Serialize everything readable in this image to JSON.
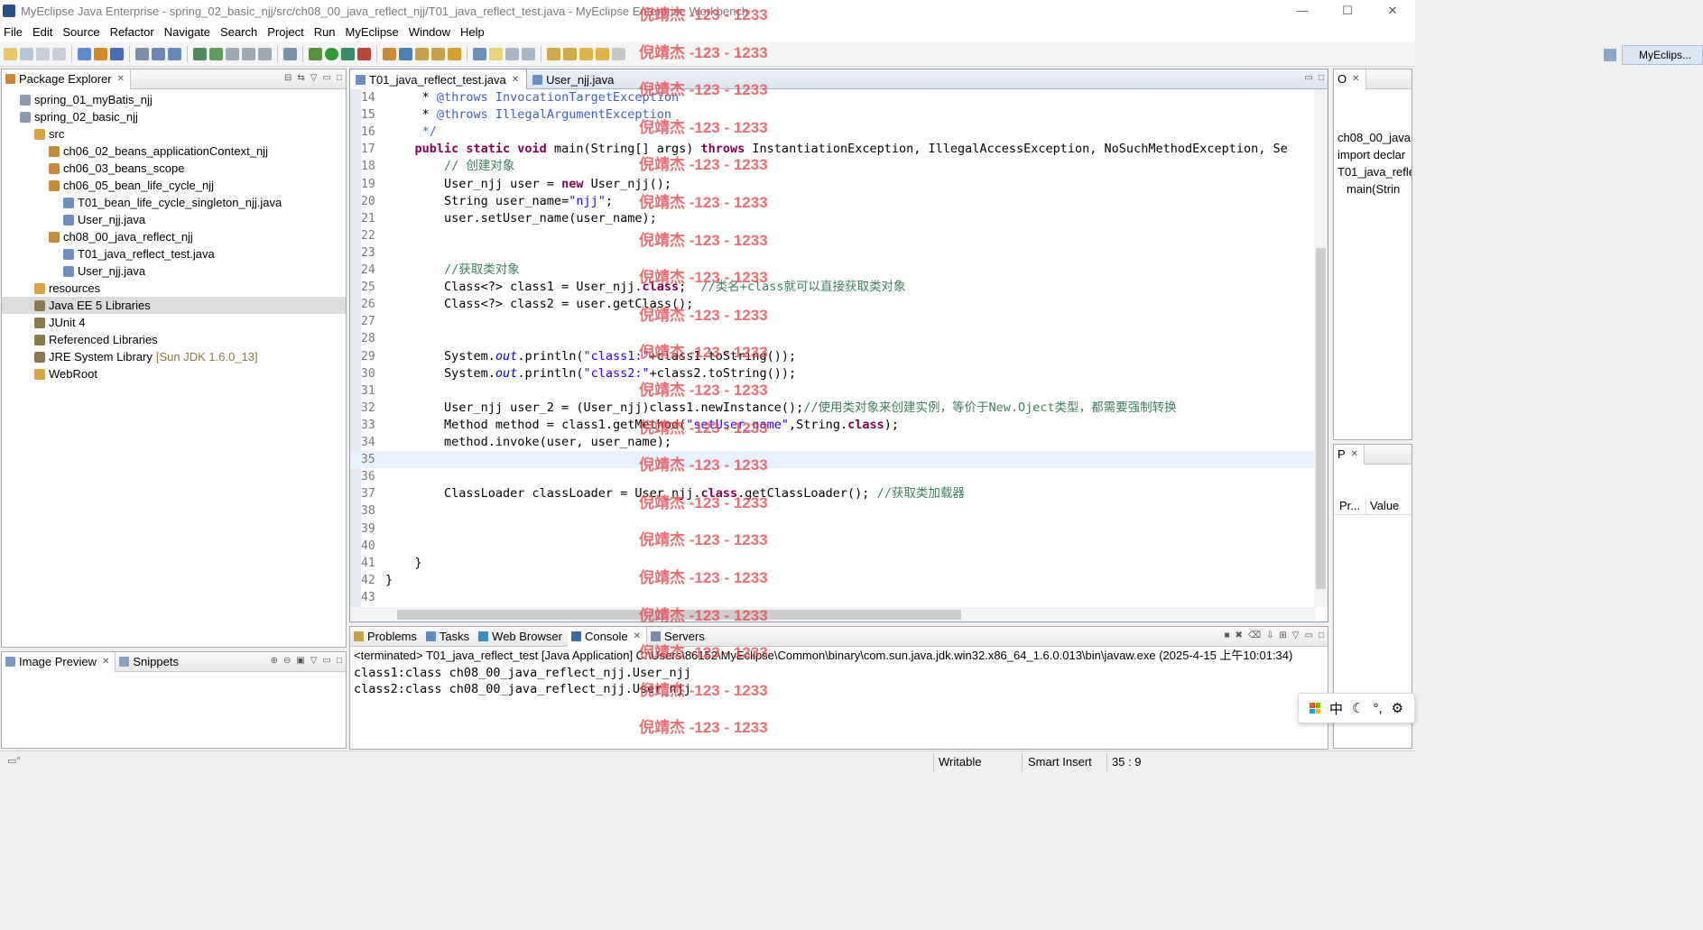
{
  "window": {
    "title": "MyEclipse Java Enterprise - spring_02_basic_njj/src/ch08_00_java_reflect_njj/T01_java_reflect_test.java - MyEclipse Enterprise Workbench",
    "controls": [
      "—",
      "☐",
      "✕"
    ]
  },
  "menu": [
    "File",
    "Edit",
    "Source",
    "Refactor",
    "Navigate",
    "Search",
    "Project",
    "Run",
    "MyEclipse",
    "Window",
    "Help"
  ],
  "perspective": {
    "label": "MyEclips..."
  },
  "package_explorer": {
    "title": "Package Explorer",
    "tree": [
      {
        "label": "spring_01_myBatis_njj",
        "indent": 1,
        "kind": "project"
      },
      {
        "label": "spring_02_basic_njj",
        "indent": 1,
        "kind": "project"
      },
      {
        "label": "src",
        "indent": 2,
        "kind": "folder"
      },
      {
        "label": "ch06_02_beans_applicationContext_njj",
        "indent": 3,
        "kind": "package"
      },
      {
        "label": "ch06_03_beans_scope",
        "indent": 3,
        "kind": "package"
      },
      {
        "label": "ch06_05_bean_life_cycle_njj",
        "indent": 3,
        "kind": "package"
      },
      {
        "label": "T01_bean_life_cycle_singleton_njj.java",
        "indent": 4,
        "kind": "file"
      },
      {
        "label": "User_njj.java",
        "indent": 4,
        "kind": "file"
      },
      {
        "label": "ch08_00_java_reflect_njj",
        "indent": 3,
        "kind": "package"
      },
      {
        "label": "T01_java_reflect_test.java",
        "indent": 4,
        "kind": "file"
      },
      {
        "label": "User_njj.java",
        "indent": 4,
        "kind": "file"
      },
      {
        "label": "resources",
        "indent": 2,
        "kind": "folder"
      },
      {
        "label": "Java EE 5 Libraries",
        "indent": 2,
        "kind": "lib",
        "selected": true
      },
      {
        "label": "JUnit 4",
        "indent": 2,
        "kind": "lib"
      },
      {
        "label": "Referenced Libraries",
        "indent": 2,
        "kind": "lib"
      },
      {
        "label": "JRE System Library",
        "decoration": "[Sun JDK 1.6.0_13]",
        "indent": 2,
        "kind": "lib"
      },
      {
        "label": "WebRoot",
        "indent": 2,
        "kind": "folder"
      }
    ]
  },
  "bottom_left": {
    "tabs": [
      "Image Preview",
      "Snippets"
    ]
  },
  "editor": {
    "tabs": [
      "T01_java_reflect_test.java",
      "User_njj.java"
    ],
    "current_line": 35,
    "lines": [
      {
        "n": "14",
        "code": "     * <span class=\"jd\">@throws InvocationTargetException</span>"
      },
      {
        "n": "15",
        "code": "     * <span class=\"jd\">@throws IllegalArgumentException</span>"
      },
      {
        "n": "16",
        "code": "     <span class=\"jd\">*/</span>"
      },
      {
        "n": "17",
        "code": "    <span class=\"kw\">public static void</span> main(String[] args) <span class=\"kw\">throws</span> InstantiationException, IllegalAccessException, NoSuchMethodException, Se"
      },
      {
        "n": "18",
        "code": "        <span class=\"cm\">// 创建对象</span>"
      },
      {
        "n": "19",
        "code": "        User_njj user = <span class=\"kw\">new</span> User_njj();"
      },
      {
        "n": "20",
        "code": "        String user_name=<span class=\"st\">\"njj\"</span>;"
      },
      {
        "n": "21",
        "code": "        user.setUser_name(user_name);"
      },
      {
        "n": "22",
        "code": ""
      },
      {
        "n": "23",
        "code": ""
      },
      {
        "n": "24",
        "code": "        <span class=\"cm\">//获取类对象</span>"
      },
      {
        "n": "25",
        "code": "        Class&lt;?&gt; class1 = User_njj.<span class=\"kw\">class</span>;  <span class=\"cm\">//类名+class就可以直接获取类对象</span>"
      },
      {
        "n": "26",
        "code": "        Class&lt;?&gt; class2 = user.getClass();"
      },
      {
        "n": "27",
        "code": ""
      },
      {
        "n": "28",
        "code": ""
      },
      {
        "n": "29",
        "code": "        System.<span class=\"fi\">out</span>.println(<span class=\"st\">\"class1:\"</span>+class1.toString());"
      },
      {
        "n": "30",
        "code": "        System.<span class=\"fi\">out</span>.println(<span class=\"st\">\"class2:\"</span>+class2.toString());"
      },
      {
        "n": "31",
        "code": ""
      },
      {
        "n": "32",
        "code": "        User_njj user_2 = (User_njj)class1.newInstance();<span class=\"cm\">//使用类对象来创建实例，等价于New.Oject类型，都需要强制转换</span>"
      },
      {
        "n": "33",
        "code": "        Method method = class1.getMethod(<span class=\"st\">\"setUser_name\"</span>,String.<span class=\"kw\">class</span>);"
      },
      {
        "n": "34",
        "code": "        method.invoke(user, user_name);"
      },
      {
        "n": "35",
        "code": ""
      },
      {
        "n": "36",
        "code": ""
      },
      {
        "n": "37",
        "code": "        ClassLoader classLoader = User_njj.<span class=\"kw\">class</span>.getClassLoader(); <span class=\"cm\">//获取类加载器</span>"
      },
      {
        "n": "38",
        "code": ""
      },
      {
        "n": "39",
        "code": ""
      },
      {
        "n": "40",
        "code": ""
      },
      {
        "n": "41",
        "code": "    }"
      },
      {
        "n": "42",
        "code": "}"
      },
      {
        "n": "43",
        "code": ""
      }
    ]
  },
  "outline": {
    "title": "O",
    "items": [
      "ch08_00_java",
      "import declar",
      "T01_java_refle",
      "main(Strin"
    ]
  },
  "properties": {
    "title": "P",
    "columns": [
      "Pr...",
      "Value"
    ]
  },
  "console": {
    "tabs": [
      "Problems",
      "Tasks",
      "Web Browser",
      "Console",
      "Servers"
    ],
    "active_tab": "Console",
    "header": "<terminated> T01_java_reflect_test [Java Application] C:\\Users\\86152\\MyEclipse\\Common\\binary\\com.sun.java.jdk.win32.x86_64_1.6.0.013\\bin\\javaw.exe (2025-4-15 上午10:01:34)",
    "output": [
      "class1:class ch08_00_java_reflect_njj.User_njj",
      "class2:class ch08_00_java_reflect_njj.User_njj"
    ]
  },
  "status": {
    "mode": "Writable",
    "insert": "Smart Insert",
    "position": "35 : 9"
  },
  "watermark": "倪靖杰 -123 - 1233",
  "ime": {
    "label": "中",
    "extra": "°,"
  },
  "colors": {
    "keyword": "#7f0055",
    "comment": "#3f7f5f",
    "javadoc": "#3f5fbf",
    "string": "#2a00ff",
    "watermark": "#e8464b"
  }
}
